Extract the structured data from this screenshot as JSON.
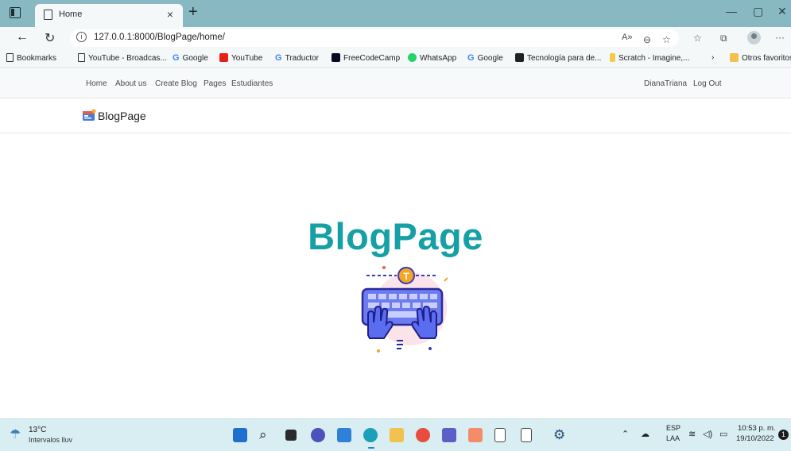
{
  "browser": {
    "tab_title": "Home",
    "tab_close": "×",
    "new_tab": "+",
    "url": "127.0.0.1:8000/BlogPage/home/",
    "window_controls": {
      "minimize": "—",
      "restore": "▢",
      "close": "✕"
    }
  },
  "bookmarks": [
    {
      "label": "Bookmarks",
      "icon": "page-icon"
    },
    {
      "label": "YouTube - Broadcas...",
      "icon": "page-icon"
    },
    {
      "label": "Google",
      "icon": "google-icon"
    },
    {
      "label": "YouTube",
      "icon": "youtube-icon"
    },
    {
      "label": "Traductor",
      "icon": "google-icon"
    },
    {
      "label": "FreeCodeCamp",
      "icon": "freecodecamp-icon"
    },
    {
      "label": "WhatsApp",
      "icon": "whatsapp-icon"
    },
    {
      "label": "Google",
      "icon": "google-icon"
    },
    {
      "label": "Tecnología para de...",
      "icon": "m-icon"
    },
    {
      "label": "Scratch - Imagine,...",
      "icon": "scratch-icon"
    }
  ],
  "bookmarks_other": "Otros favoritos",
  "site": {
    "nav": {
      "home": "Home",
      "about": "About us",
      "create": "Create Blog",
      "pages": "Pages",
      "students": "Estudiantes",
      "user": "DianaTriana",
      "logout": "Log Out"
    },
    "brand": "BlogPage",
    "hero_title": "BlogPage"
  },
  "taskbar": {
    "temperature": "13°C",
    "weather": "Intervalos lluv",
    "language": "ESP",
    "layout": "LAA",
    "time": "10:53 p. m.",
    "date": "19/10/2022",
    "notifications": "1"
  },
  "colors": {
    "tabbar": "#88b9c2",
    "hero_title": "#15a0a6",
    "taskbar": "#d8eef2"
  }
}
